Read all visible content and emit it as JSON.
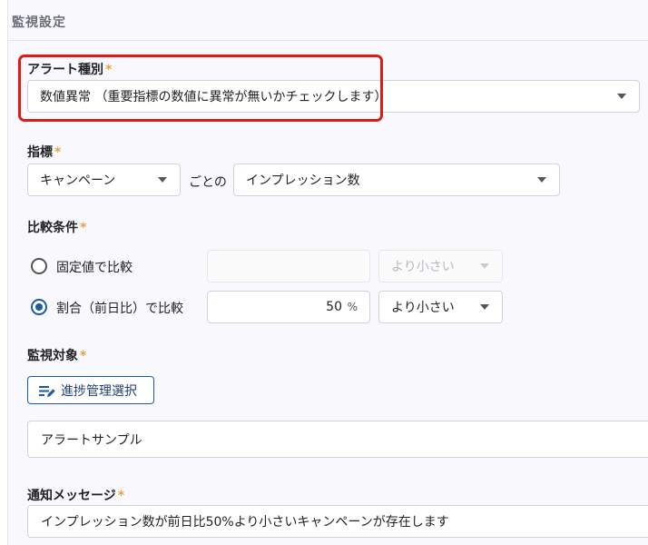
{
  "panel": {
    "title": "監視設定"
  },
  "alert_type": {
    "label": "アラート種別",
    "required_mark": "*",
    "selected": "数値異常 （重要指標の数値に異常が無いかチェックします）"
  },
  "metric": {
    "label": "指標",
    "required_mark": "*",
    "level_selected": "キャンペーン",
    "connector": "ごとの",
    "metric_selected": "インプレッション数"
  },
  "comparison": {
    "label": "比較条件",
    "required_mark": "*",
    "fixed": {
      "label": "固定値で比較",
      "selected": false,
      "value": "",
      "operator": "より小さい"
    },
    "ratio": {
      "label": "割合（前日比）で比較",
      "selected": true,
      "value": "50",
      "unit": "%",
      "operator": "より小さい"
    }
  },
  "target": {
    "label": "監視対象",
    "required_mark": "*",
    "button_label": "進捗管理選択",
    "value": "アラートサンプル"
  },
  "message": {
    "label": "通知メッセージ",
    "required_mark": "*",
    "value": "インプレッション数が前日比50%より小さいキャンペーンが存在します"
  },
  "colors": {
    "accent": "#1c5aa6",
    "required": "#e8a33d",
    "highlight": "#e01919"
  }
}
